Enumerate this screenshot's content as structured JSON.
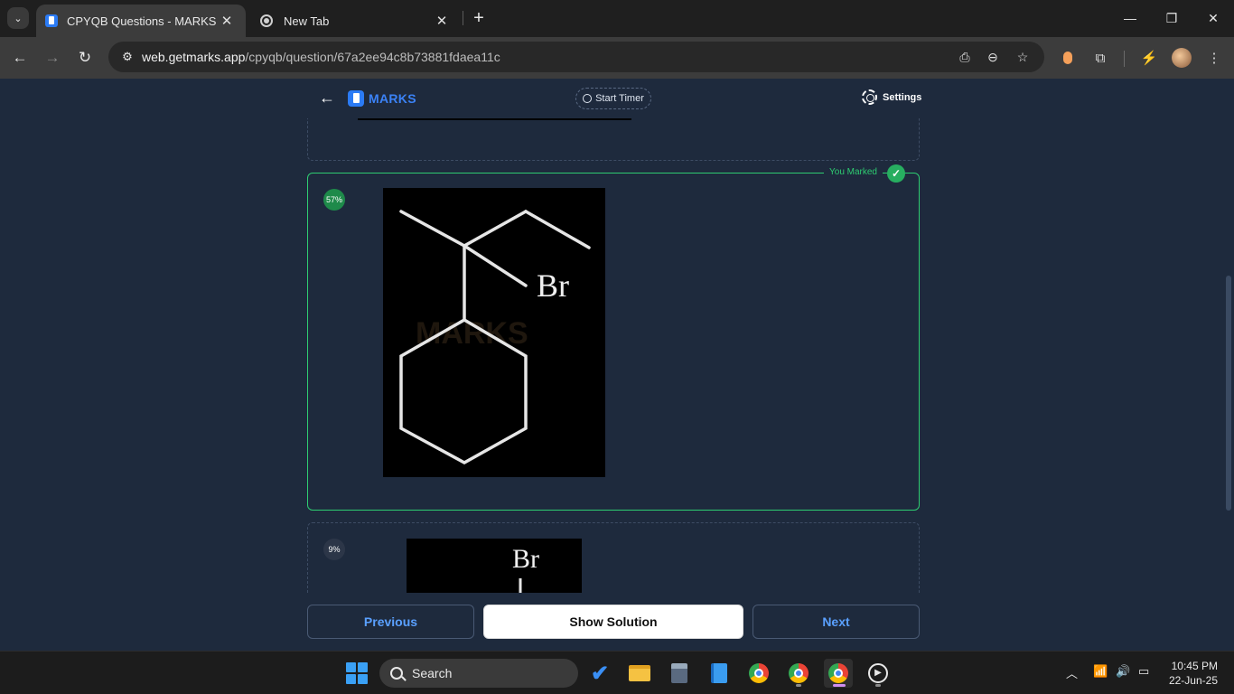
{
  "browser": {
    "tabs": [
      {
        "title": "CPYQB Questions - MARKS App",
        "active": true
      },
      {
        "title": "New Tab",
        "active": false
      }
    ],
    "url_host": "web.getmarks.app",
    "url_path": "/cpyqb/question/67a2ee94c8b73881fdaea11c"
  },
  "app": {
    "logo": "MARKS",
    "start_timer": "Start Timer",
    "settings": "Settings"
  },
  "options": [
    {
      "id": "A",
      "percent": ""
    },
    {
      "id": "B",
      "percent": "57%",
      "marked_label": "You Marked",
      "molecule_label": "Br",
      "watermark": "MARKS"
    },
    {
      "id": "C",
      "percent": "9%",
      "molecule_label": "Br"
    }
  ],
  "buttons": {
    "previous": "Previous",
    "show_solution": "Show Solution",
    "next": "Next"
  },
  "taskbar": {
    "search_placeholder": "Search",
    "time": "10:45 PM",
    "date": "22-Jun-25"
  }
}
